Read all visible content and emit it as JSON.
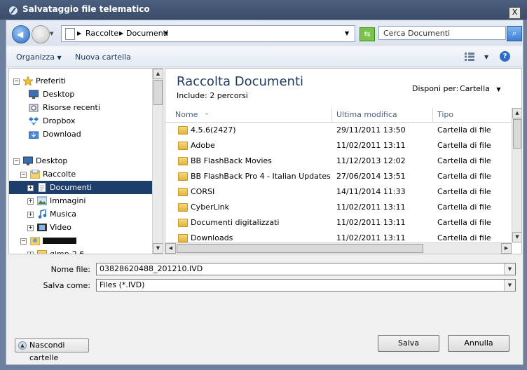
{
  "window": {
    "title": "Salvataggio file telematico",
    "close_glyph": "X"
  },
  "nav": {
    "breadcrumb": [
      "Raccolte",
      "Documenti"
    ],
    "search_placeholder": "Cerca Documenti"
  },
  "toolbar": {
    "organize": "Organizza",
    "new_folder": "Nuova cartella"
  },
  "tree": {
    "favorites_label": "Preferiti",
    "favorites": [
      "Desktop",
      "Risorse recenti",
      "Dropbox",
      "Download"
    ],
    "desktop_label": "Desktop",
    "libraries_label": "Raccolte",
    "libraries": [
      "Documenti",
      "Immagini",
      "Musica",
      "Video"
    ],
    "user_label": "",
    "sub_item": "gimp-2.6"
  },
  "library": {
    "title": "Raccolta Documenti",
    "includes": "Include:  2 percorsi",
    "arrange_by_label": "Disponi per:",
    "arrange_by_value": "Cartella"
  },
  "columns": {
    "name": "Nome",
    "modified": "Ultima modifica",
    "type": "Tipo"
  },
  "files": [
    {
      "name": "4.5.6(2427)",
      "modified": "29/11/2011 13:50",
      "type": "Cartella di file"
    },
    {
      "name": "Adobe",
      "modified": "11/02/2011 13:11",
      "type": "Cartella di file"
    },
    {
      "name": "BB FlashBack Movies",
      "modified": "11/12/2013 12:02",
      "type": "Cartella di file"
    },
    {
      "name": "BB FlashBack Pro 4 - Italian Updates",
      "modified": "27/06/2014 13:51",
      "type": "Cartella di file"
    },
    {
      "name": "CORSI",
      "modified": "14/11/2014 11:33",
      "type": "Cartella di file"
    },
    {
      "name": "CyberLink",
      "modified": "11/02/2011 13:11",
      "type": "Cartella di file"
    },
    {
      "name": "Documenti digitalizzati",
      "modified": "11/02/2011 13:11",
      "type": "Cartella di file"
    },
    {
      "name": "Downloads",
      "modified": "11/02/2011 13:11",
      "type": "Cartella di file"
    }
  ],
  "form": {
    "filename_label": "Nome file:",
    "filename_value": "03828620488_201210.IVD",
    "savetype_label": "Salva come:",
    "savetype_value": "Files (*.IVD)"
  },
  "buttons": {
    "hide_folders": "Nascondi cartelle",
    "save": "Salva",
    "cancel": "Annulla"
  }
}
